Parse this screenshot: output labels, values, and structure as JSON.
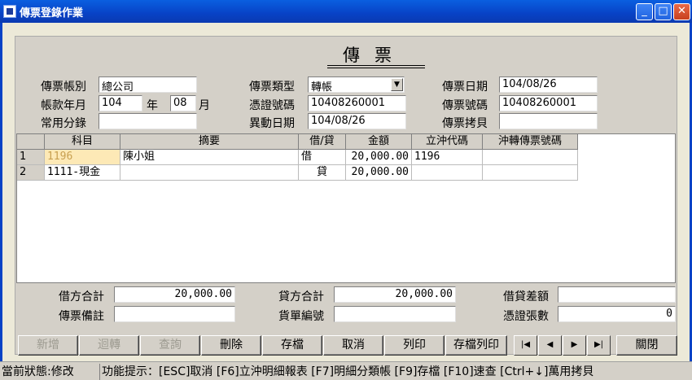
{
  "window": {
    "title": "傳票登錄作業",
    "minimize": "_",
    "maximize": "□",
    "close": "✕"
  },
  "heading": "傳票",
  "form": {
    "account_book_label": "傳票帳別",
    "account_book_value": "總公司",
    "period_label": "帳款年月",
    "year_value": "104",
    "year_unit": "年",
    "month_value": "08",
    "month_unit": "月",
    "common_entry_label": "常用分錄",
    "common_entry_value": "",
    "voucher_type_label": "傳票類型",
    "voucher_type_value": "轉帳",
    "cert_no_label": "憑證號碼",
    "cert_no_value": "10408260001",
    "change_date_label": "異動日期",
    "change_date_value": "104/08/26",
    "voucher_date_label": "傳票日期",
    "voucher_date_value": "104/08/26",
    "voucher_no_label": "傳票號碼",
    "voucher_no_value": "10408260001",
    "voucher_copy_label": "傳票拷貝",
    "voucher_copy_value": ""
  },
  "grid": {
    "headers": [
      "科目",
      "摘要",
      "借/貸",
      "金額",
      "立沖代碼",
      "沖轉傳票號碼"
    ],
    "rows": [
      {
        "num": "1",
        "account": "1196",
        "summary": "陳小姐",
        "dc": "借",
        "amount": "20,000.00",
        "code": "1196",
        "reverse_no": ""
      },
      {
        "num": "2",
        "account": "1111-現金",
        "summary": "",
        "dc": "貸",
        "amount": "20,000.00",
        "code": "",
        "reverse_no": ""
      }
    ]
  },
  "totals": {
    "debit_total_label": "借方合計",
    "debit_total_value": "20,000.00",
    "credit_total_label": "貸方合計",
    "credit_total_value": "20,000.00",
    "balance_diff_label": "借貸差額",
    "balance_diff_value": "",
    "voucher_note_label": "傳票備註",
    "voucher_note_value": "",
    "doc_no_label": "貨單編號",
    "doc_no_value": "",
    "cert_count_label": "憑證張數",
    "cert_count_value": "0"
  },
  "buttons": {
    "add": "新增",
    "reverse": "迴轉",
    "query": "查詢",
    "delete": "刪除",
    "save": "存檔",
    "cancel": "取消",
    "print": "列印",
    "save_print": "存檔列印",
    "close": "關閉"
  },
  "nav": {
    "first": "|◀",
    "prev": "◀",
    "next": "▶",
    "last": "▶|"
  },
  "status": {
    "state": "當前狀態:修改",
    "hint": "功能提示：[ESC]取消 [F6]立沖明細報表 [F7]明細分類帳 [F9]存檔 [F10]速查 [Ctrl+↓]萬用拷貝"
  },
  "colors": {
    "title_bar": "#0842c6",
    "selected_cell": "#fde9b6",
    "disabled_text": "#9c9a90"
  }
}
